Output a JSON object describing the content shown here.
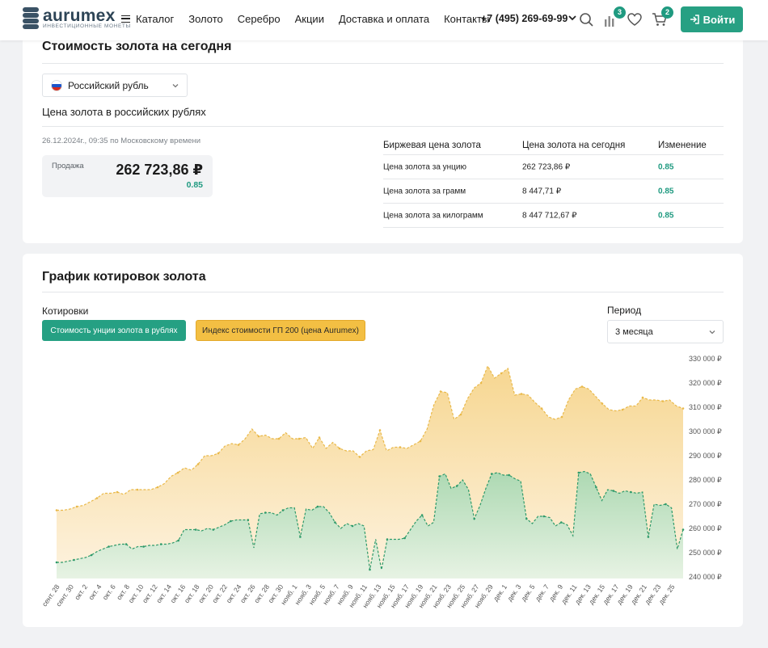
{
  "header": {
    "logo_name": "aurumex",
    "logo_tagline": "ИНВЕСТИЦИОННЫЕ МОНЕТЫ",
    "nav": [
      "Каталог",
      "Золото",
      "Серебро",
      "Акции",
      "Доставка и оплата",
      "Контакты"
    ],
    "phone": "+7 (495) 269-69-99",
    "compare_count": "3",
    "cart_count": "2",
    "login_label": "Войти",
    "accent_color": "#27a083"
  },
  "price_card": {
    "title": "Стоимость золота на сегодня",
    "currency": "Российский рубль",
    "subtitle": "Цена золота в российских рублях",
    "updated": "26.12.2024г., 09:35 по Московскому времени",
    "sell_label": "Продажа",
    "sell_value": "262 723,86 ₽",
    "sell_change": "0.85",
    "table": {
      "headers": [
        "Биржевая цена золота",
        "Цена золота на сегодня",
        "Изменение"
      ],
      "rows": [
        {
          "name": "Цена золота за унцию",
          "price": "262 723,86 ₽",
          "change": "0.85"
        },
        {
          "name": "Цена золота за грамм",
          "price": "8 447,71 ₽",
          "change": "0.85"
        },
        {
          "name": "Цена золота за килограмм",
          "price": "8 447 712,67 ₽",
          "change": "0.85"
        }
      ]
    }
  },
  "chart_card": {
    "title": "График котировок золота",
    "quotes_label": "Котировки",
    "btn_ounce": "Стоимость унции золота в рублях",
    "btn_index": "Индекс стоимости ГП 200 (цена Aurumex)",
    "period_label": "Период",
    "period_value": "3 месяца"
  },
  "chart_data": {
    "type": "area",
    "ylim": [
      240000,
      330000
    ],
    "y_ticks": [
      "330 000 ₽",
      "320 000 ₽",
      "310 000 ₽",
      "300 000 ₽",
      "290 000 ₽",
      "280 000 ₽",
      "270 000 ₽",
      "260 000 ₽",
      "250 000 ₽",
      "240 000 ₽"
    ],
    "y_tick_values": [
      330000,
      320000,
      310000,
      300000,
      290000,
      280000,
      270000,
      260000,
      250000,
      240000
    ],
    "x_labels": [
      "сент. 28",
      "сент. 30",
      "окт. 2",
      "окт. 4",
      "окт. 6",
      "окт. 8",
      "окт. 10",
      "окт. 12",
      "окт. 14",
      "окт. 16",
      "окт. 18",
      "окт. 20",
      "окт. 22",
      "окт. 24",
      "окт. 26",
      "окт. 28",
      "окт. 30",
      "нояб. 1",
      "нояб. 3",
      "нояб. 5",
      "нояб. 7",
      "нояб. 9",
      "нояб. 11",
      "нояб. 13",
      "нояб. 15",
      "нояб. 17",
      "нояб. 19",
      "нояб. 21",
      "нояб. 23",
      "нояб. 25",
      "нояб. 27",
      "нояб. 29",
      "дек. 1",
      "дек. 3",
      "дек. 5",
      "дек. 7",
      "дек. 9",
      "дек. 11",
      "дек. 13",
      "дек. 15",
      "дек. 17",
      "дек. 19",
      "дек. 21",
      "дек. 23",
      "дек. 25"
    ],
    "series": [
      {
        "color": "#e9b94a",
        "fill": "#f6d99a",
        "values": [
          267500,
          267500,
          268000,
          269000,
          269500,
          271000,
          272500,
          274500,
          274500,
          275000,
          274000,
          276000,
          276000,
          276000,
          276000,
          277000,
          278500,
          281500,
          283000,
          285000,
          284000,
          286500,
          290000,
          290000,
          291000,
          294000,
          295000,
          294500,
          297000,
          301000,
          298000,
          298500,
          297000,
          297000,
          299500,
          297000,
          297000,
          297500,
          293000,
          297500,
          293000,
          295500,
          293000,
          292000,
          292000,
          289500,
          292000,
          292500,
          300500,
          292000,
          293500,
          293500,
          293000,
          294500,
          296000,
          301000,
          311000,
          316500,
          316000,
          305000,
          307000,
          313500,
          318000,
          320000,
          327000,
          322000,
          324000,
          326000,
          315000,
          315500,
          315000,
          312000,
          309500,
          306000,
          305000,
          306000,
          313000,
          317500,
          318500,
          317500,
          314500,
          311500,
          309000,
          308500,
          309000,
          310500,
          310500,
          314000,
          313000,
          313000,
          312500,
          313000,
          310500,
          309500
        ],
        "xmap_note": ""
      },
      {
        "color": "#2e9a6a",
        "fill": "#bfe2c6",
        "values": [
          246000,
          246000,
          246500,
          247000,
          247500,
          248000,
          249000,
          250500,
          251500,
          252500,
          253000,
          253500,
          253500,
          251500,
          252500,
          252500,
          253000,
          253000,
          253500,
          253500,
          254000,
          255000,
          259500,
          259500,
          259500,
          259000,
          260000,
          259500,
          260500,
          261500,
          263000,
          263500,
          263500,
          263500,
          252000,
          266000,
          266500,
          266500,
          265500,
          267500,
          268500,
          268500,
          256500,
          268000,
          267500,
          269000,
          269000,
          266500,
          262500,
          260000,
          262000,
          261000,
          262000,
          261000,
          243000,
          255500,
          243000,
          255500,
          255500,
          255500,
          256000,
          259500,
          263000,
          265500,
          261000,
          262500,
          281500,
          282500,
          276500,
          277500,
          280000,
          276000,
          264000,
          269500,
          276500,
          282500,
          283000,
          282000,
          282000,
          280500,
          279500,
          264000,
          262000,
          265000,
          265000,
          264500,
          261000,
          262500,
          261500,
          257000,
          283000,
          283500,
          282500,
          277000,
          271500,
          276000,
          275500,
          274500,
          275500,
          275000,
          274500,
          275000,
          256500,
          270000,
          269500,
          270000,
          268500,
          251500,
          259500
        ]
      }
    ]
  }
}
